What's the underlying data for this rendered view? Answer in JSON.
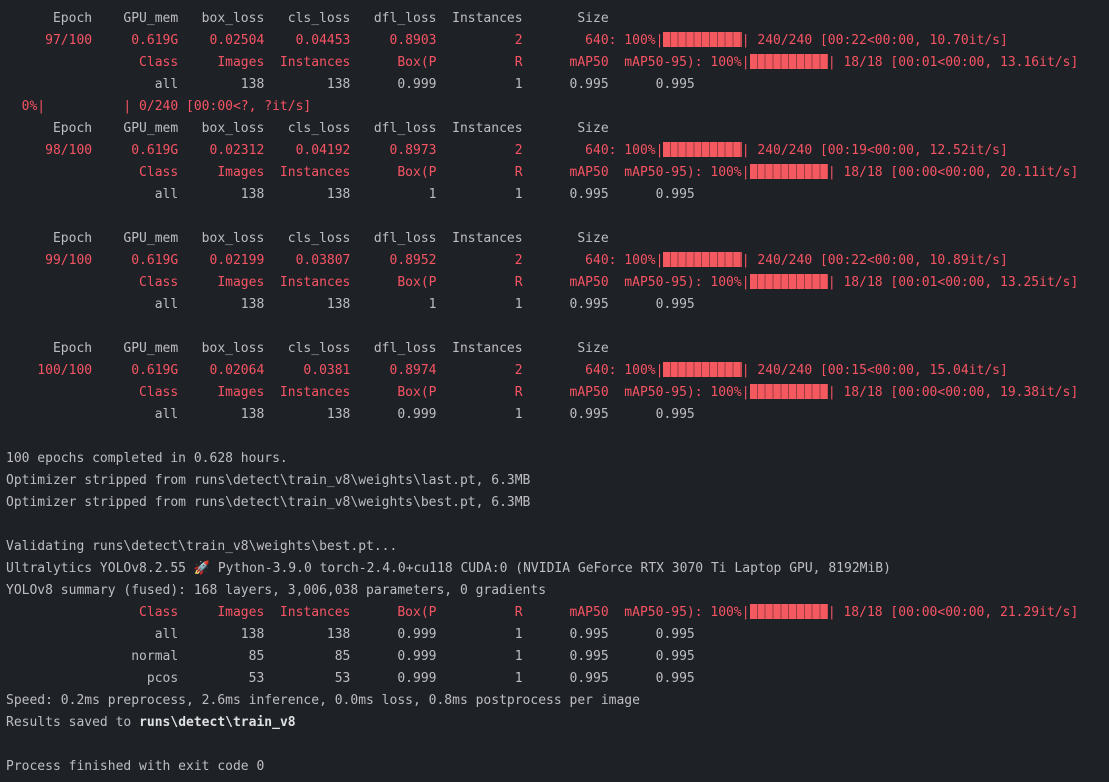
{
  "terminal": {
    "colors": {
      "background": "#1e2125",
      "foreground": "#bcbec4",
      "red": "#f75464",
      "bar_fill": "#f4595f",
      "bar_gap": "#9e3a41",
      "bold_text": "#dfe1e5"
    },
    "lines": [
      {
        "segments": [
          {
            "t": "      Epoch    GPU_mem   box_loss   cls_loss   dfl_loss  Instances       Size",
            "c": "fg"
          }
        ]
      },
      {
        "segments": [
          {
            "t": "     97/100     0.619G    0.02504    0.04453     0.8903          2        640: 100%|",
            "c": "red"
          },
          {
            "bar": true
          },
          {
            "t": "| 240/240 [00:22<00:00, 10.70it/s]",
            "c": "red"
          }
        ]
      },
      {
        "segments": [
          {
            "t": "                 Class     Images  Instances      Box(P          R      mAP50  mAP50-95): 100%|",
            "c": "red"
          },
          {
            "bar": true
          },
          {
            "t": "| 18/18 [00:01<00:00, 13.16it/s]",
            "c": "red"
          }
        ]
      },
      {
        "segments": [
          {
            "t": "                   all        138        138      0.999          1      0.995      0.995",
            "c": "fg"
          }
        ]
      },
      {
        "segments": [
          {
            "t": "  0%|          | 0/240 [00:00<?, ?it/s]",
            "c": "red"
          }
        ]
      },
      {
        "segments": [
          {
            "t": "      Epoch    GPU_mem   box_loss   cls_loss   dfl_loss  Instances       Size",
            "c": "fg"
          }
        ]
      },
      {
        "segments": [
          {
            "t": "     98/100     0.619G    0.02312    0.04192     0.8973          2        640: 100%|",
            "c": "red"
          },
          {
            "bar": true
          },
          {
            "t": "| 240/240 [00:19<00:00, 12.52it/s]",
            "c": "red"
          }
        ]
      },
      {
        "segments": [
          {
            "t": "                 Class     Images  Instances      Box(P          R      mAP50  mAP50-95): 100%|",
            "c": "red"
          },
          {
            "bar": true
          },
          {
            "t": "| 18/18 [00:00<00:00, 20.11it/s]",
            "c": "red"
          }
        ]
      },
      {
        "segments": [
          {
            "t": "                   all        138        138          1          1      0.995      0.995",
            "c": "fg"
          }
        ]
      },
      {
        "segments": []
      },
      {
        "segments": [
          {
            "t": "      Epoch    GPU_mem   box_loss   cls_loss   dfl_loss  Instances       Size",
            "c": "fg"
          }
        ]
      },
      {
        "segments": [
          {
            "t": "     99/100     0.619G    0.02199    0.03807     0.8952          2        640: 100%|",
            "c": "red"
          },
          {
            "bar": true
          },
          {
            "t": "| 240/240 [00:22<00:00, 10.89it/s]",
            "c": "red"
          }
        ]
      },
      {
        "segments": [
          {
            "t": "                 Class     Images  Instances      Box(P          R      mAP50  mAP50-95): 100%|",
            "c": "red"
          },
          {
            "bar": true
          },
          {
            "t": "| 18/18 [00:01<00:00, 13.25it/s]",
            "c": "red"
          }
        ]
      },
      {
        "segments": [
          {
            "t": "                   all        138        138          1          1      0.995      0.995",
            "c": "fg"
          }
        ]
      },
      {
        "segments": []
      },
      {
        "segments": [
          {
            "t": "      Epoch    GPU_mem   box_loss   cls_loss   dfl_loss  Instances       Size",
            "c": "fg"
          }
        ]
      },
      {
        "segments": [
          {
            "t": "    100/100     0.619G    0.02064     0.0381     0.8974          2        640: 100%|",
            "c": "red"
          },
          {
            "bar": true
          },
          {
            "t": "| 240/240 [00:15<00:00, 15.04it/s]",
            "c": "red"
          }
        ]
      },
      {
        "segments": [
          {
            "t": "                 Class     Images  Instances      Box(P          R      mAP50  mAP50-95): 100%|",
            "c": "red"
          },
          {
            "bar": true
          },
          {
            "t": "| 18/18 [00:00<00:00, 19.38it/s]",
            "c": "red"
          }
        ]
      },
      {
        "segments": [
          {
            "t": "                   all        138        138      0.999          1      0.995      0.995",
            "c": "fg"
          }
        ]
      },
      {
        "segments": []
      },
      {
        "segments": [
          {
            "t": "100 epochs completed in 0.628 hours.",
            "c": "fg"
          }
        ]
      },
      {
        "segments": [
          {
            "t": "Optimizer stripped from runs\\detect\\train_v8\\weights\\last.pt, 6.3MB",
            "c": "fg"
          }
        ]
      },
      {
        "segments": [
          {
            "t": "Optimizer stripped from runs\\detect\\train_v8\\weights\\best.pt, 6.3MB",
            "c": "fg"
          }
        ]
      },
      {
        "segments": []
      },
      {
        "segments": [
          {
            "t": "Validating runs\\detect\\train_v8\\weights\\best.pt...",
            "c": "fg"
          }
        ]
      },
      {
        "segments": [
          {
            "t": "Ultralytics YOLOv8.2.55 ",
            "c": "fg"
          },
          {
            "t": "🚀",
            "c": "fg",
            "e": true,
            "n": "rocket-emoji-icon"
          },
          {
            "t": " Python-3.9.0 torch-2.4.0+cu118 CUDA:0 (NVIDIA GeForce RTX 3070 Ti Laptop GPU, 8192MiB)",
            "c": "fg"
          }
        ]
      },
      {
        "segments": [
          {
            "t": "YOLOv8 summary (fused): 168 layers, 3,006,038 parameters, 0 gradients",
            "c": "fg"
          }
        ]
      },
      {
        "segments": [
          {
            "t": "                 Class     Images  Instances      Box(P          R      mAP50  mAP50-95): 100%|",
            "c": "red"
          },
          {
            "bar": true
          },
          {
            "t": "| 18/18 [00:00<00:00, 21.29it/s]",
            "c": "red"
          }
        ]
      },
      {
        "segments": [
          {
            "t": "                   all        138        138      0.999          1      0.995      0.995",
            "c": "fg"
          }
        ]
      },
      {
        "segments": [
          {
            "t": "                normal         85         85      0.999          1      0.995      0.995",
            "c": "fg"
          }
        ]
      },
      {
        "segments": [
          {
            "t": "                  pcos         53         53      0.999          1      0.995      0.995",
            "c": "fg"
          }
        ]
      },
      {
        "segments": [
          {
            "t": "Speed: 0.2ms preprocess, 2.6ms inference, 0.0ms loss, 0.8ms postprocess per image",
            "c": "fg"
          }
        ]
      },
      {
        "segments": [
          {
            "t": "Results saved to ",
            "c": "fg"
          },
          {
            "t": "runs\\detect\\train_v8",
            "c": "fg",
            "b": true,
            "n": "results-path"
          }
        ]
      },
      {
        "segments": []
      },
      {
        "segments": [
          {
            "t": "Process finished with exit code 0",
            "c": "fg"
          }
        ]
      }
    ]
  }
}
